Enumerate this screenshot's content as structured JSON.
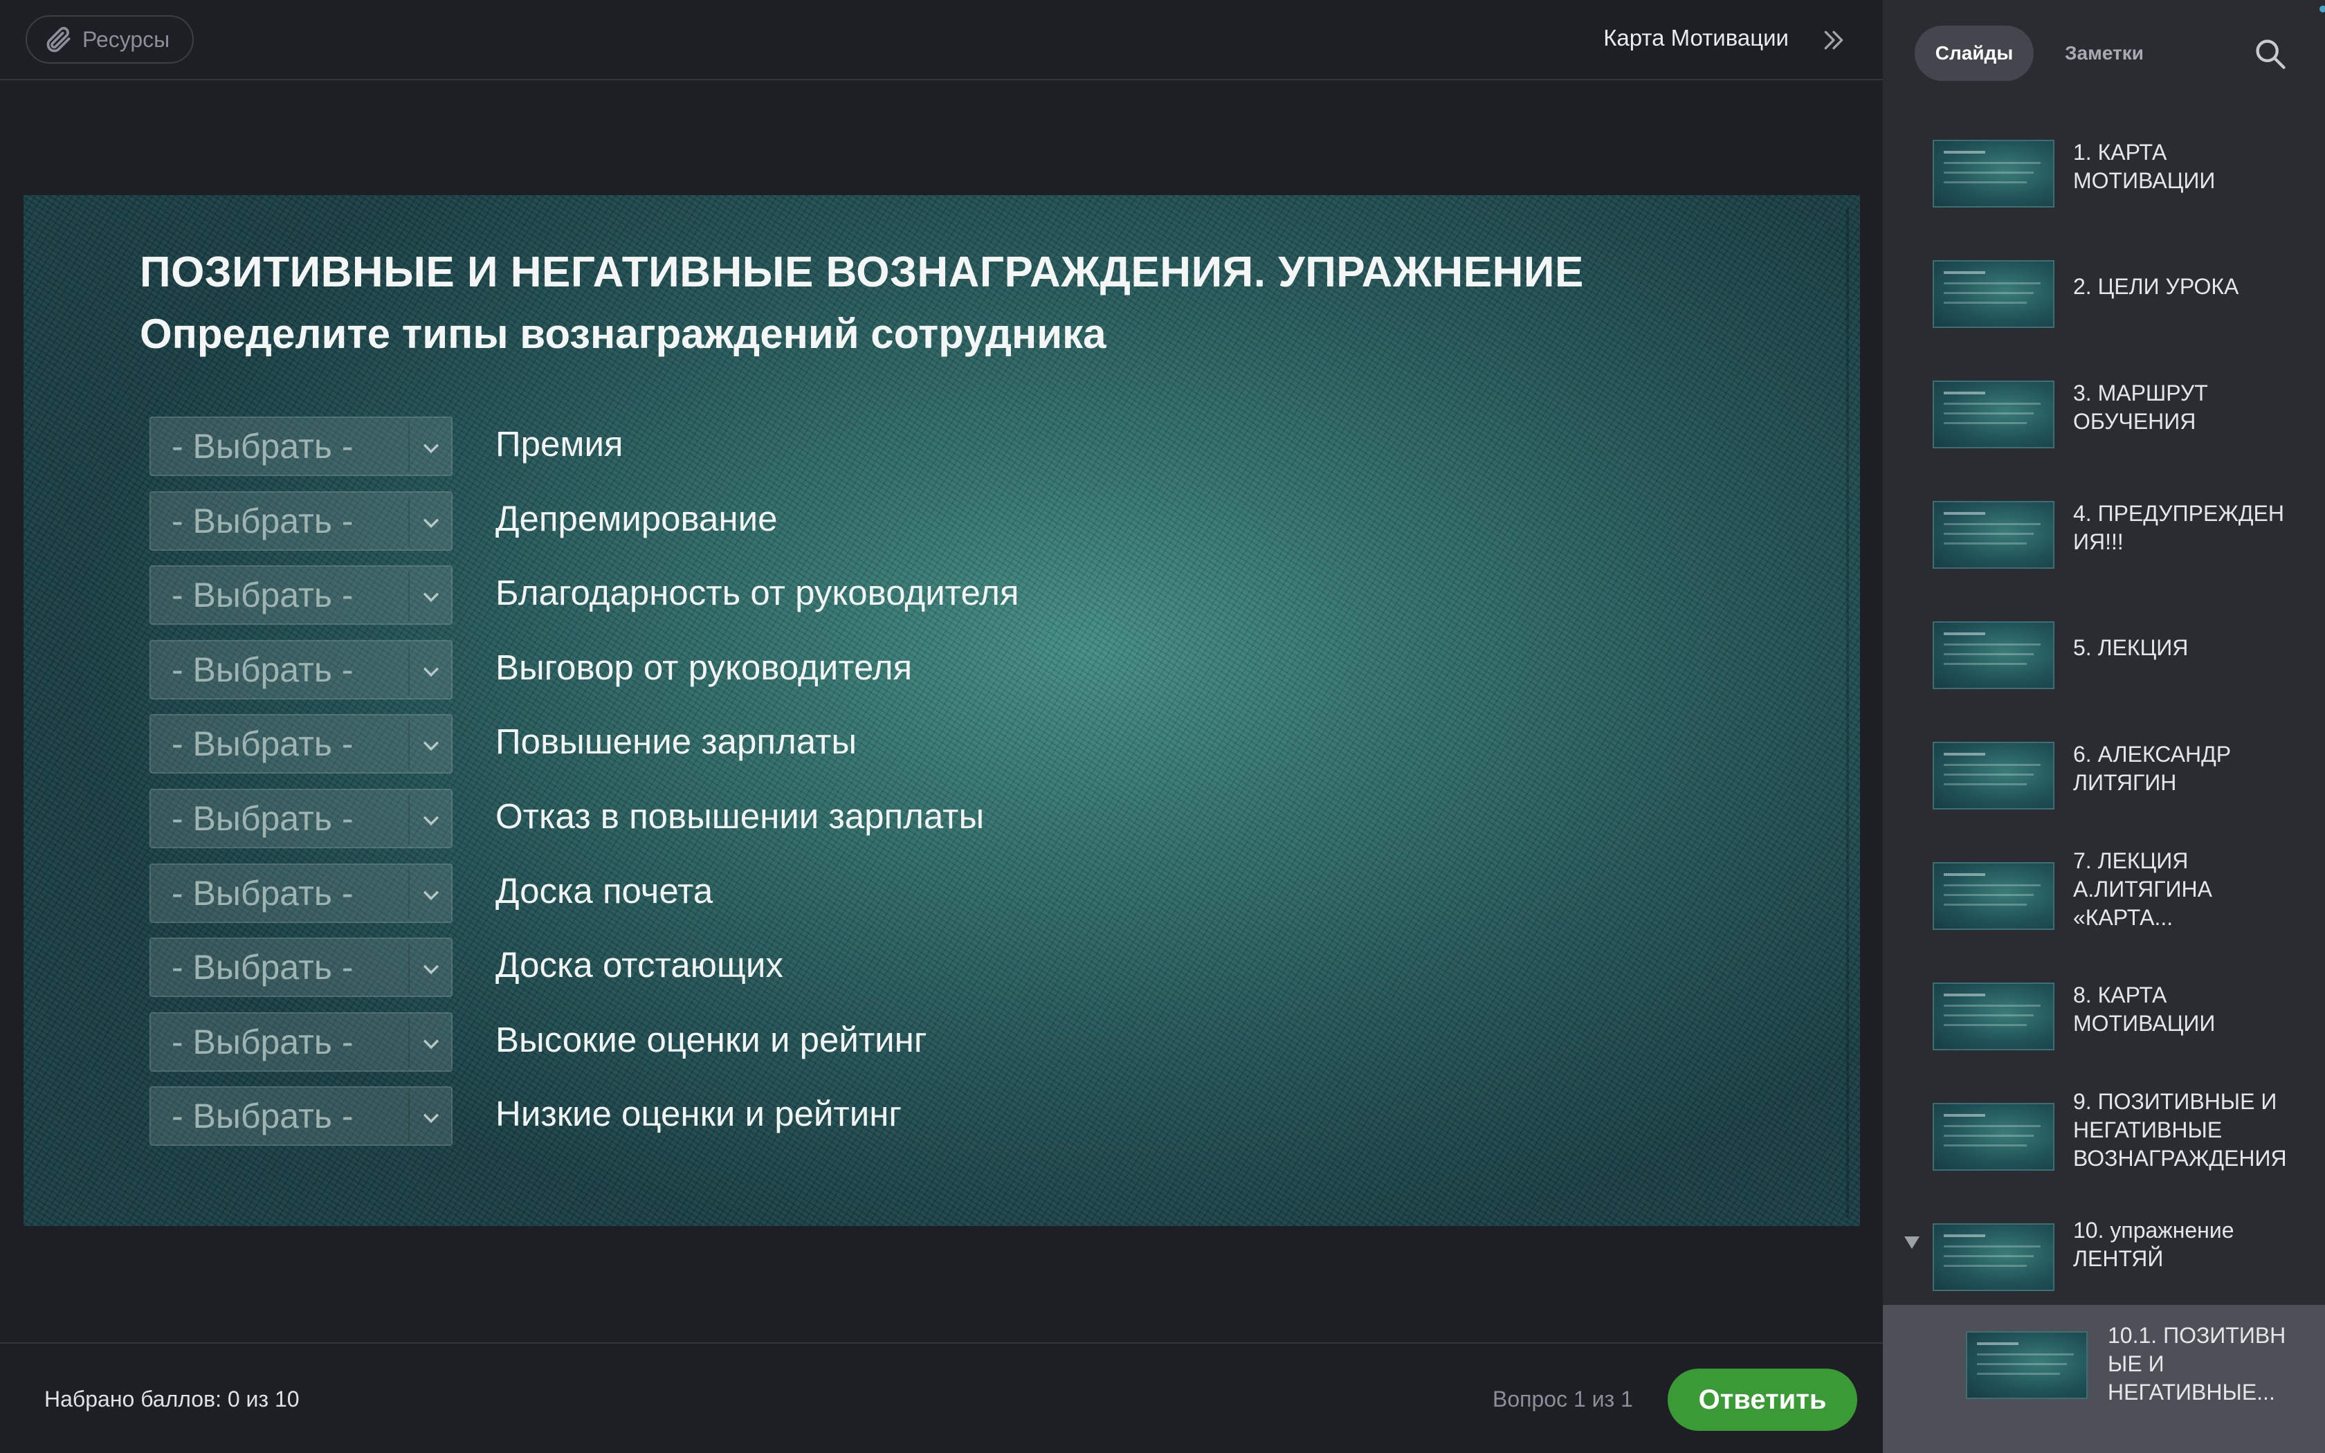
{
  "header": {
    "resources_label": "Ресурсы",
    "course_title": "Карта Мотивации"
  },
  "slide": {
    "title": "ПОЗИТИВНЫЕ И НЕГАТИВНЫЕ ВОЗНАГРАЖДЕНИЯ. УПРАЖНЕНИЕ",
    "subtitle": "Определите типы вознаграждений сотрудника",
    "rows": [
      {
        "select": "- Выбрать -",
        "label": "Премия"
      },
      {
        "select": "- Выбрать -",
        "label": "Депремирование"
      },
      {
        "select": "- Выбрать -",
        "label": "Благодарность от руководителя"
      },
      {
        "select": "- Выбрать -",
        "label": "Выговор от руководителя"
      },
      {
        "select": "- Выбрать -",
        "label": "Повышение зарплаты"
      },
      {
        "select": "- Выбрать -",
        "label": "Отказ в повышении зарплаты"
      },
      {
        "select": "- Выбрать -",
        "label": "Доска почета"
      },
      {
        "select": "- Выбрать -",
        "label": "Доска отстающих"
      },
      {
        "select": "- Выбрать -",
        "label": "Высокие оценки и рейтинг"
      },
      {
        "select": "- Выбрать -",
        "label": "Низкие оценки и рейтинг"
      }
    ]
  },
  "footer": {
    "score": "Набрано баллов: 0 из 10",
    "question_count": "Вопрос 1 из 1",
    "answer_label": "Ответить"
  },
  "sidebar": {
    "tabs": [
      "Слайды",
      "Заметки"
    ],
    "items": [
      {
        "title": "1. КАРТА МОТИВАЦИИ"
      },
      {
        "title": "2. ЦЕЛИ УРОКА"
      },
      {
        "title": "3. МАРШРУТ ОБУЧЕНИЯ"
      },
      {
        "title": "4. ПРЕДУПРЕЖДЕН ИЯ!!!"
      },
      {
        "title": "5. ЛЕКЦИЯ"
      },
      {
        "title": "6. АЛЕКСАНДР ЛИТЯГИН"
      },
      {
        "title": "7. ЛЕКЦИЯ А.ЛИТЯГИНА «КАРТА..."
      },
      {
        "title": "8. КАРТА МОТИВАЦИИ"
      },
      {
        "title": "9. ПОЗИТИВНЫЕ И НЕГАТИВНЫЕ ВОЗНАГРАЖДЕНИЯ"
      },
      {
        "title": "10. упражнение ЛЕНТЯЙ"
      }
    ],
    "current_item": {
      "title": "10.1. ПОЗИТИВН ЫЕ И НЕГАТИВНЫЕ..."
    }
  },
  "colors": {
    "accent_green": "#3a9a35",
    "background": "#1e1f25",
    "sidebar": "#2a2c32"
  }
}
